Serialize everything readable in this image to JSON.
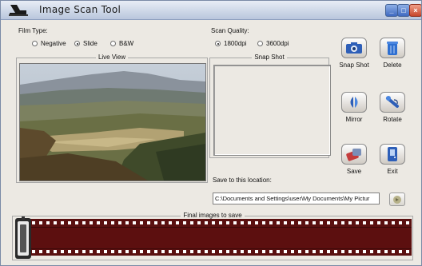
{
  "window": {
    "title": "Image Scan Tool"
  },
  "film_type": {
    "label": "Film Type:",
    "options": [
      {
        "label": "Negative",
        "selected": false
      },
      {
        "label": "Slide",
        "selected": true
      },
      {
        "label": "B&W",
        "selected": false
      }
    ]
  },
  "scan_quality": {
    "label": "Scan Quality:",
    "options": [
      {
        "label": "1800dpi",
        "selected": true
      },
      {
        "label": "3600dpi",
        "selected": false
      }
    ]
  },
  "live_view": {
    "title": "Live  View"
  },
  "snap_shot": {
    "title": "Snap Shot"
  },
  "actions": {
    "snap_shot": "Snap Shot",
    "delete": "Delete",
    "mirror": "Mirror",
    "rotate": "Rotate",
    "save": "Save",
    "exit": "Exit"
  },
  "save_location": {
    "label": "Save to this location:",
    "path": "C:\\Documents and Settings\\user\\My Documents\\My Pictur"
  },
  "final_images": {
    "title": "Final images to save"
  },
  "colors": {
    "film": "#5a1010",
    "button_blue": "#3f6ac0"
  }
}
